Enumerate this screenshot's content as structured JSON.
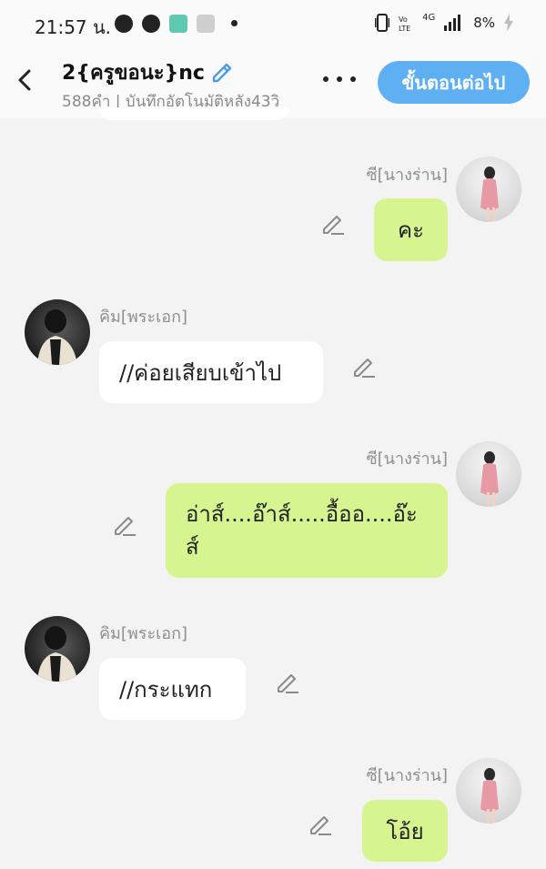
{
  "status_bar": {
    "time": "21:57 น.",
    "battery_pct": "8%",
    "network_label": "4G"
  },
  "header": {
    "title": "2{ครูขอนะ}nc",
    "subtitle": "588คำ | บันทึกอัตโนมัติหลัง43วิ",
    "next_button": "ขั้นตอนต่อไป"
  },
  "messages": [
    {
      "side": "right",
      "speaker": "ซี[นางร่าน]",
      "text": "คะ"
    },
    {
      "side": "left",
      "speaker": "คิม[พระเอก]",
      "text": "//ค่อยเสียบเข้าไป"
    },
    {
      "side": "right",
      "speaker": "ซี[นางร่าน]",
      "text_line1": "อ่าส์....อ๊าส์.....อื้ออ....อ๊ะ",
      "text_line2": "ส์"
    },
    {
      "side": "left",
      "speaker": "คิม[พระเอก]",
      "text": "//กระแทก"
    },
    {
      "side": "right",
      "speaker": "ซี[นางร่าน]",
      "text": "โอ้ย"
    }
  ]
}
